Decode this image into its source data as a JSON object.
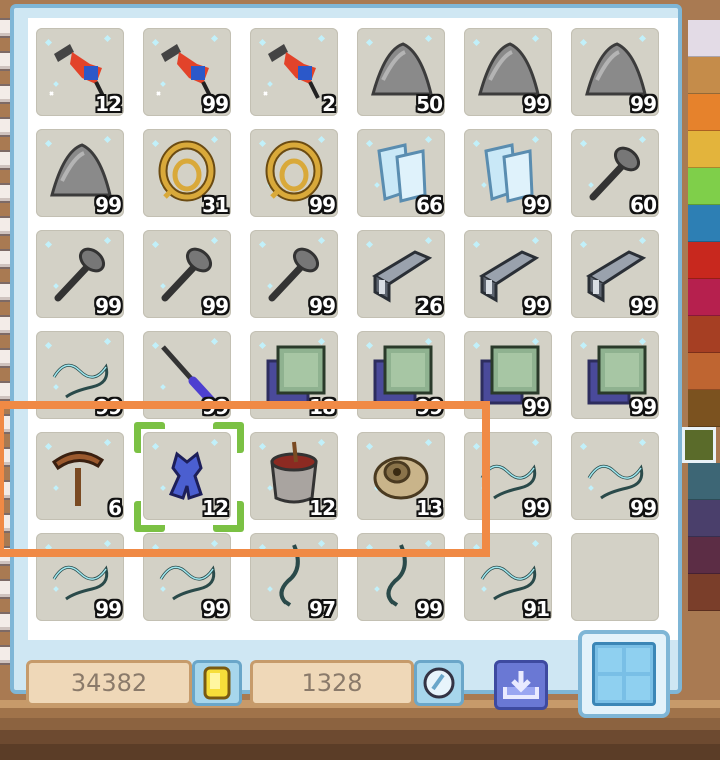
{
  "inventory": {
    "rows": [
      [
        {
          "icon": "drill-item-icon",
          "qty": "12"
        },
        {
          "icon": "drill-item-icon",
          "qty": "99"
        },
        {
          "icon": "drill-item-icon",
          "qty": "2"
        },
        {
          "icon": "stone-pile-icon",
          "qty": "50"
        },
        {
          "icon": "stone-pile-icon",
          "qty": "99"
        },
        {
          "icon": "stone-pile-icon",
          "qty": "99"
        }
      ],
      [
        {
          "icon": "stone-pile-icon",
          "qty": "99"
        },
        {
          "icon": "rope-coil-icon",
          "qty": "31"
        },
        {
          "icon": "rope-coil-icon",
          "qty": "99"
        },
        {
          "icon": "glass-pane-icon",
          "qty": "66"
        },
        {
          "icon": "glass-pane-icon",
          "qty": "99"
        },
        {
          "icon": "hammer-tool-icon",
          "qty": "60"
        }
      ],
      [
        {
          "icon": "hammer-tool-icon",
          "qty": "99"
        },
        {
          "icon": "hammer-tool-icon",
          "qty": "99"
        },
        {
          "icon": "hammer-tool-icon",
          "qty": "99"
        },
        {
          "icon": "iron-beam-icon",
          "qty": "26"
        },
        {
          "icon": "iron-beam-icon",
          "qty": "99"
        },
        {
          "icon": "iron-beam-icon",
          "qty": "99"
        }
      ],
      [
        {
          "icon": "wire-icon",
          "qty": "99"
        },
        {
          "icon": "screwdriver-icon",
          "qty": "99"
        },
        {
          "icon": "green-panel-icon",
          "qty": "18"
        },
        {
          "icon": "green-panel-icon",
          "qty": "99"
        },
        {
          "icon": "green-panel-icon",
          "qty": "99"
        },
        {
          "icon": "green-panel-icon",
          "qty": "99"
        }
      ],
      [
        {
          "icon": "pickaxe-icon",
          "qty": "6"
        },
        {
          "icon": "blue-gear-icon",
          "qty": "12"
        },
        {
          "icon": "paint-bucket-icon",
          "qty": "12"
        },
        {
          "icon": "wood-spool-icon",
          "qty": "13"
        },
        {
          "icon": "wire-icon",
          "qty": "99"
        },
        {
          "icon": "wire-icon",
          "qty": "99"
        }
      ],
      [
        {
          "icon": "wire-icon",
          "qty": "99"
        },
        {
          "icon": "wire-icon",
          "qty": "99"
        },
        {
          "icon": "hook-wire-icon",
          "qty": "97"
        },
        {
          "icon": "hook-wire-icon",
          "qty": "99"
        },
        {
          "icon": "wire-icon",
          "qty": "91"
        },
        {
          "icon": "empty-slot",
          "qty": ""
        }
      ]
    ],
    "selected": {
      "row": 4,
      "col": 1
    }
  },
  "currency": {
    "coins": "34382",
    "gems": "1328",
    "coin_icon": "gold-coin-icon",
    "gem_icon": "crystal-orb-icon"
  },
  "buttons": {
    "download": "download-icon",
    "grid_view": "grid-view-icon"
  },
  "color_tabs": [
    "#e3dbe6",
    "#c58c4a",
    "#e6822c",
    "#e3b43c",
    "#7fcf4a",
    "#2d7fb4",
    "#c8281e",
    "#b6204e",
    "#a63f23",
    "#bf6531",
    "#7b521f",
    "#5a6b2a",
    "#3d6675",
    "#4a3f6b",
    "#5c2d45",
    "#7a3e2a"
  ],
  "colors": {
    "accent": "#f08a45",
    "selection": "#7bc144",
    "frame": "#7fb6d6"
  }
}
